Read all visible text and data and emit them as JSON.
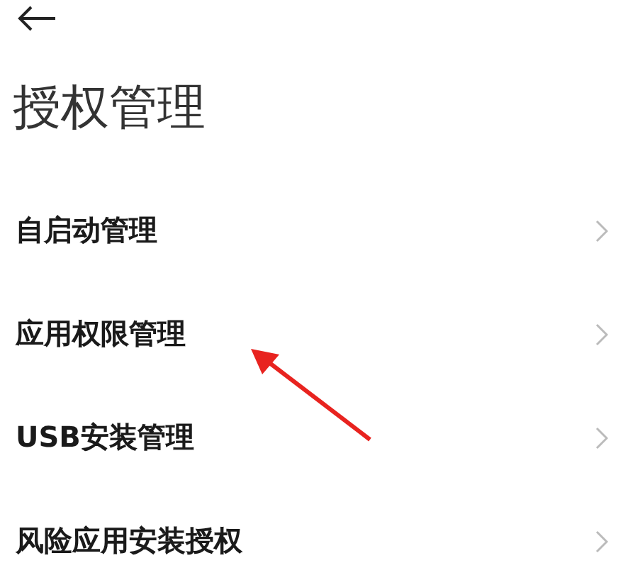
{
  "title": "授权管理",
  "items": [
    {
      "label": "自启动管理"
    },
    {
      "label": "应用权限管理"
    },
    {
      "label": "USB安装管理"
    },
    {
      "label": "风险应用安装授权"
    }
  ]
}
